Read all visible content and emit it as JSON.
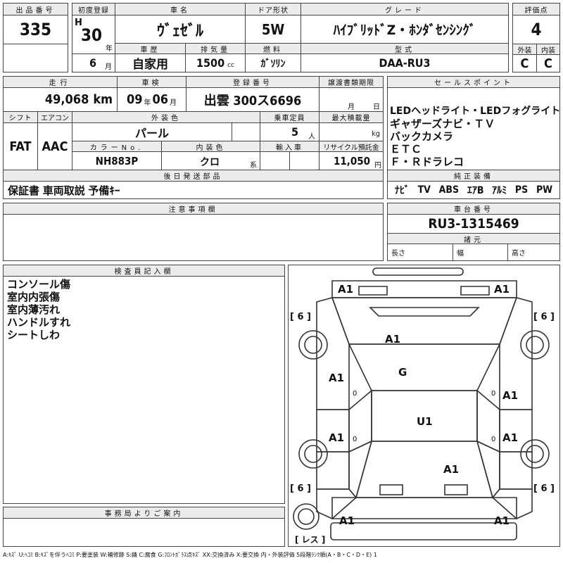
{
  "header": {
    "lot_label": "出品番号",
    "lot": "335",
    "reg_label": "初度登録",
    "reg_era": "H",
    "reg_year": "30",
    "year_unit": "年",
    "reg_month": "6",
    "month_unit": "月",
    "name_label": "車名",
    "name": "ｳﾞｪｾﾞﾙ",
    "doors_label": "ドア形状",
    "doors": "5W",
    "grade_label": "グレード",
    "grade": "ﾊｲﾌﾞﾘｯﾄﾞZ・ﾎﾝﾀﾞｾﾝｼﾝｸﾞ",
    "score_label": "評価点",
    "score": "4",
    "history_label": "車歴",
    "history": "自家用",
    "displacement_label": "排気量",
    "displacement": "1500",
    "displacement_unit": "cc",
    "fuel_label": "燃料",
    "fuel": "ｶﾞｿﾘﾝ",
    "model_label": "型式",
    "model": "DAA-RU3",
    "ext_label": "外装",
    "ext": "C",
    "int_label": "内装",
    "int": "C"
  },
  "row2": {
    "mileage_label": "走行",
    "mileage": "49,068",
    "mileage_unit": "km",
    "inspection_label": "車検",
    "insp_year": "09",
    "insp_year_unit": "年",
    "insp_month": "06",
    "insp_month_unit": "月",
    "plate_label": "登録番号",
    "plate": "出雲 300ス6696",
    "transfer_label": "譲渡書類期限",
    "transfer_month_unit": "月",
    "transfer_day_unit": "日",
    "shift_label": "シフト",
    "shift": "FAT",
    "ac_label": "エアコン",
    "ac": "AAC",
    "color_label": "外装色",
    "color": "パール",
    "capacity_label": "乗車定員",
    "capacity": "5",
    "capacity_unit": "人",
    "load_label": "最大積載量",
    "load_unit": "kg",
    "color_no_label": "カラーNo.",
    "color_no": "NH883P",
    "interior_color_label": "内装色",
    "interior_color": "クロ",
    "interior_color_suffix": "系",
    "import_label": "輸入車",
    "recycle_label": "リサイクル預託金",
    "recycle": "11,050",
    "recycle_unit": "円"
  },
  "selling_points": {
    "label": "セールスポイント",
    "lines": [
      "LEDヘッドライト・LEDフォグライト",
      "ギャザーズナビ・ＴＶ",
      "バックカメラ",
      "ＥＴＣ",
      "Ｆ・Ｒドラレコ"
    ]
  },
  "accessories": {
    "label": "後日発送部品",
    "value": "保証書 車両取説 予備ｷｰ"
  },
  "equipment": {
    "label": "純正装備",
    "items": [
      "ﾅﾋﾞ",
      "TV",
      "ABS",
      "ｴｱB",
      "ｱﾙﾐ",
      "PS",
      "PW"
    ]
  },
  "notes": {
    "label": "注意事項欄"
  },
  "chassis": {
    "label": "車台番号",
    "value": "RU3-1315469",
    "dims_label": "諸元",
    "length_label": "長さ",
    "width_label": "幅",
    "height_label": "高さ"
  },
  "inspector": {
    "label": "検査員記入欄",
    "lines": [
      "コンソール傷",
      "室内内張傷",
      "室内薄汚れ",
      "ハンドルすれ",
      "シートしわ"
    ]
  },
  "office": {
    "label": "事務局よりご案内"
  },
  "diagram": {
    "tire_label": "[ 6 ]",
    "spare_label": "[ レス ]",
    "marks": {
      "front_left_corner": "A1",
      "front_right_corner": "A1",
      "windshield": "A1",
      "roof_front": "G",
      "left_front_door": "A1",
      "right_front_door": "A1",
      "roof_center": "U1",
      "left_rear_door": "A1",
      "right_rear_door": "A1",
      "rear_glass": "A1",
      "rear_left_corner": "A1",
      "rear_right_corner": "A1",
      "left_front_zero": "0",
      "right_front_zero": "0",
      "left_rear_zero": "0",
      "right_rear_zero": "0"
    }
  },
  "legend": "A:ｷｽﾞ U:ﾍｺﾐ B:ｷｽﾞを伴うﾍｺﾐ P:要塗装 W:補修跡 S:錆 C:腐食 G:ﾌﾛﾝﾄｶﾞﾗｽ点ｷｽﾞ XX:交換済み X:要交換 内・外装評価 5段階ﾗﾝｸ順(A・B・C・D・E) 1"
}
